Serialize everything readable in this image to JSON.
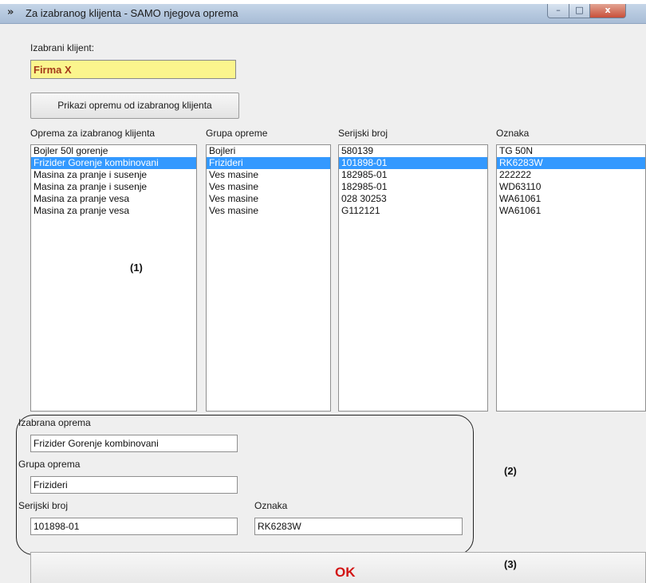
{
  "window": {
    "title": "Za izabranog klijenta - SAMO njegova oprema",
    "controls": {
      "minimize": "–",
      "maximize": "□",
      "close": "x"
    }
  },
  "client": {
    "label": "Izabrani klijent:",
    "value": "Firma X",
    "field_color": "#fbf58d"
  },
  "show_button": {
    "label": "Prikazi opremu od izabranog klijenta"
  },
  "lists": {
    "equipment": {
      "header": "Oprema za izabranog klijenta",
      "items": [
        "Bojler 50l gorenje",
        "Frizider Gorenje kombinovani",
        "Masina za pranje i susenje",
        "Masina za pranje i susenje",
        "Masina za pranje vesa",
        "Masina za pranje vesa"
      ],
      "selected_index": 1
    },
    "group": {
      "header": "Grupa opreme",
      "items": [
        "Bojleri",
        "Frizideri",
        "Ves masine",
        "Ves masine",
        "Ves masine",
        "Ves masine"
      ],
      "selected_index": 1
    },
    "serial": {
      "header": "Serijski broj",
      "items": [
        "580139",
        "101898-01",
        "182985-01",
        "182985-01",
        "028 30253",
        "G112121"
      ],
      "selected_index": 1
    },
    "tag": {
      "header": "Oznaka",
      "items": [
        "TG 50N",
        "RK6283W",
        "222222",
        "WD63110",
        "WA61061",
        "WA61061"
      ],
      "selected_index": 1
    },
    "selection_color": "#3399ff"
  },
  "annotations": {
    "one": "(1)",
    "two": "(2)",
    "three": "(3)"
  },
  "details": {
    "equipment_label": "Izabrana oprema",
    "equipment_value": "Frizider Gorenje kombinovani",
    "group_label": "Grupa oprema",
    "group_value": "Frizideri",
    "serial_label": "Serijski broj",
    "serial_value": "101898-01",
    "tag_label": "Oznaka",
    "tag_value": "RK6283W"
  },
  "ok_button": {
    "label": "OK",
    "color": "#d21414"
  }
}
